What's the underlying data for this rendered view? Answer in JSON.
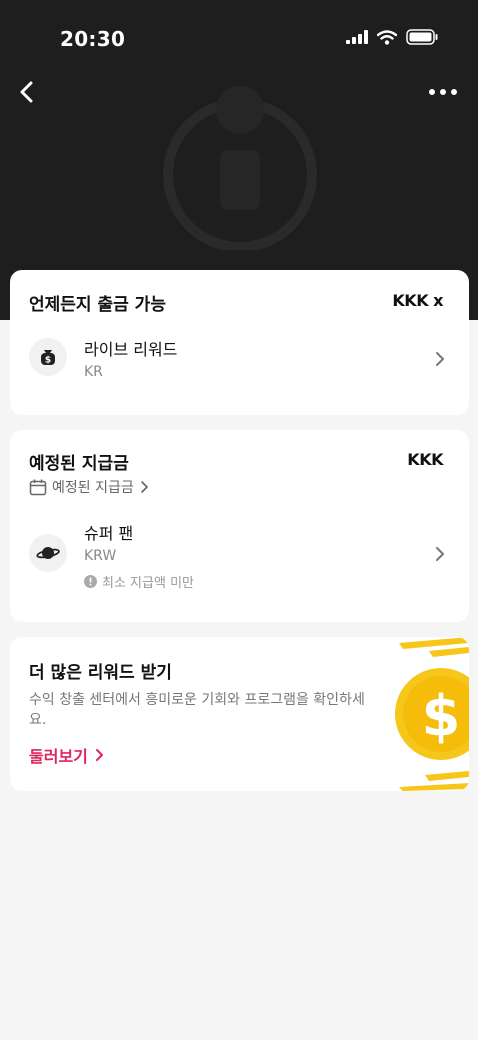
{
  "status_bar": {
    "time": "20:30"
  },
  "balance_card": {
    "title": "언제든지 출금 가능",
    "amount": "KKK x",
    "live_reward": {
      "label": "라이브 리워드",
      "amount": "KR"
    }
  },
  "scheduled_card": {
    "title": "예정된 지급금",
    "amount": "KKK",
    "link_label": "예정된 지급금",
    "super_fan": {
      "label": "슈퍼 팬",
      "amount": "KRW",
      "note": "최소 지급액 미만"
    }
  },
  "promo_card": {
    "title": "더 많은 리워드 받기",
    "description": "수익 창출 센터에서 흥미로운 기회와 프로그램을 확인하세요.",
    "link_label": "둘러보기",
    "coin_color": "#f7c61b"
  },
  "colors": {
    "accent": "#e0245e",
    "header_bg": "#1e1e1e"
  },
  "icons": [
    "back-icon",
    "more-icon",
    "money-bag-icon",
    "planet-icon",
    "calendar-icon",
    "chevron-right-icon",
    "info-icon",
    "dollar-coin-icon"
  ]
}
